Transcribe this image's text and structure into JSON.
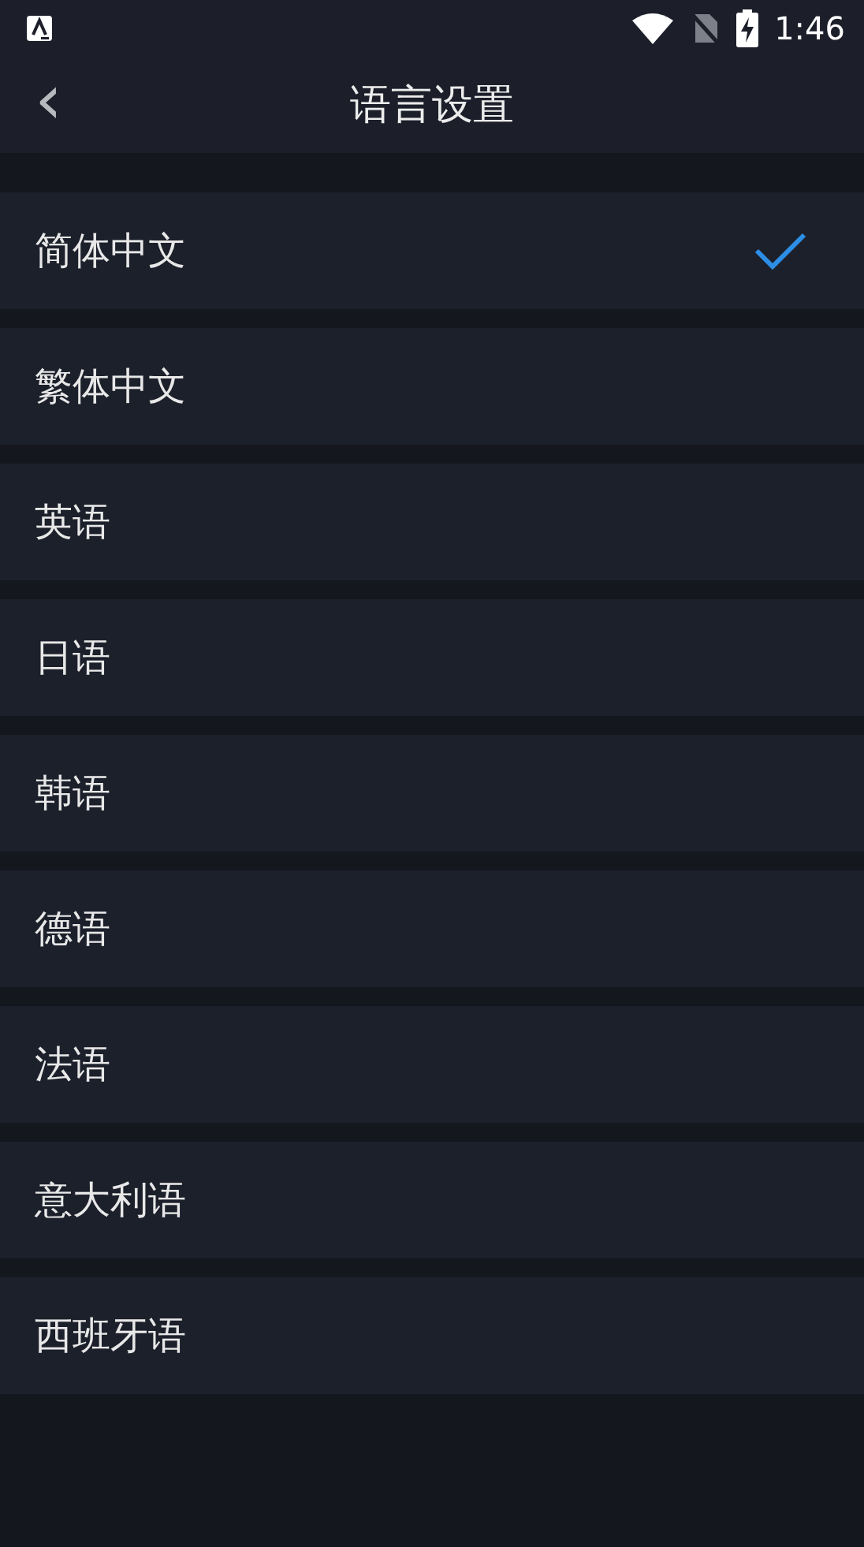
{
  "status_bar": {
    "time": "1:46"
  },
  "header": {
    "back_icon": "‹",
    "title": "语言设置"
  },
  "languages": [
    {
      "label": "简体中文",
      "selected": true
    },
    {
      "label": "繁体中文",
      "selected": false
    },
    {
      "label": "英语",
      "selected": false
    },
    {
      "label": "日语",
      "selected": false
    },
    {
      "label": "韩语",
      "selected": false
    },
    {
      "label": "德语",
      "selected": false
    },
    {
      "label": "法语",
      "selected": false
    },
    {
      "label": "意大利语",
      "selected": false
    },
    {
      "label": "西班牙语",
      "selected": false
    }
  ]
}
